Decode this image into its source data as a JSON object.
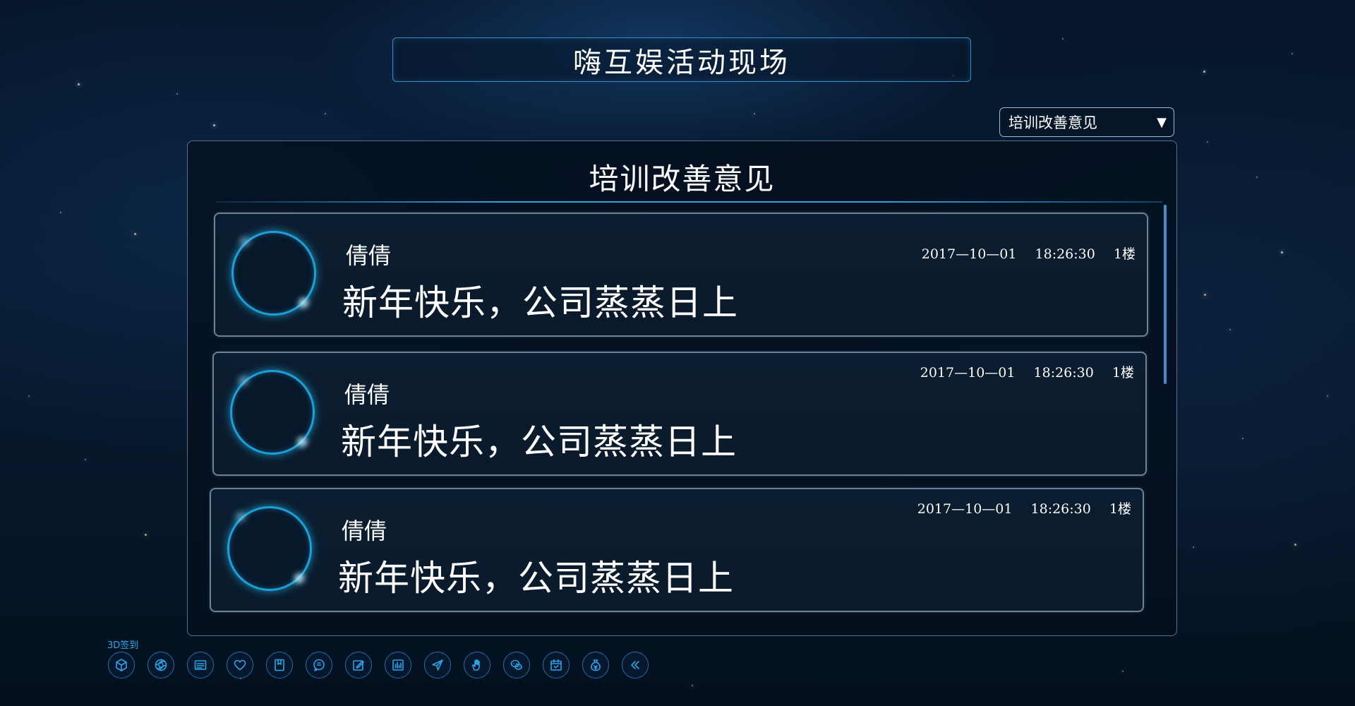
{
  "header": {
    "title": "嗨互娱活动现场"
  },
  "category_select": {
    "selected": "培训改善意见",
    "arrow_icon": "triangle-down-icon"
  },
  "panel": {
    "title": "培训改善意见"
  },
  "posts": [
    {
      "user": "倩倩",
      "message": "新年快乐，公司蒸蒸日上",
      "date": "2017—10—01",
      "time": "18:26:30",
      "floor": "1楼"
    },
    {
      "user": "倩倩",
      "message": "新年快乐，公司蒸蒸日上",
      "date": "2017—10—01",
      "time": "18:26:30",
      "floor": "1楼"
    },
    {
      "user": "倩倩",
      "message": "新年快乐，公司蒸蒸日上",
      "date": "2017—10—01",
      "time": "18:26:30",
      "floor": "1楼"
    }
  ],
  "toolbar": {
    "label": "3D签到",
    "icons": [
      "cube-icon",
      "aperture-icon",
      "list-icon",
      "heart-icon",
      "bookmark-icon",
      "chat-bubble-icon",
      "edit-icon",
      "bar-chart-icon",
      "send-icon",
      "hand-icon",
      "wechat-icon",
      "calendar-icon",
      "money-bag-icon",
      "double-chevron-left-icon"
    ]
  },
  "colors": {
    "accent": "#2ba3e6",
    "avatar_ring": "#1c9fd6",
    "background": "#06162a"
  }
}
